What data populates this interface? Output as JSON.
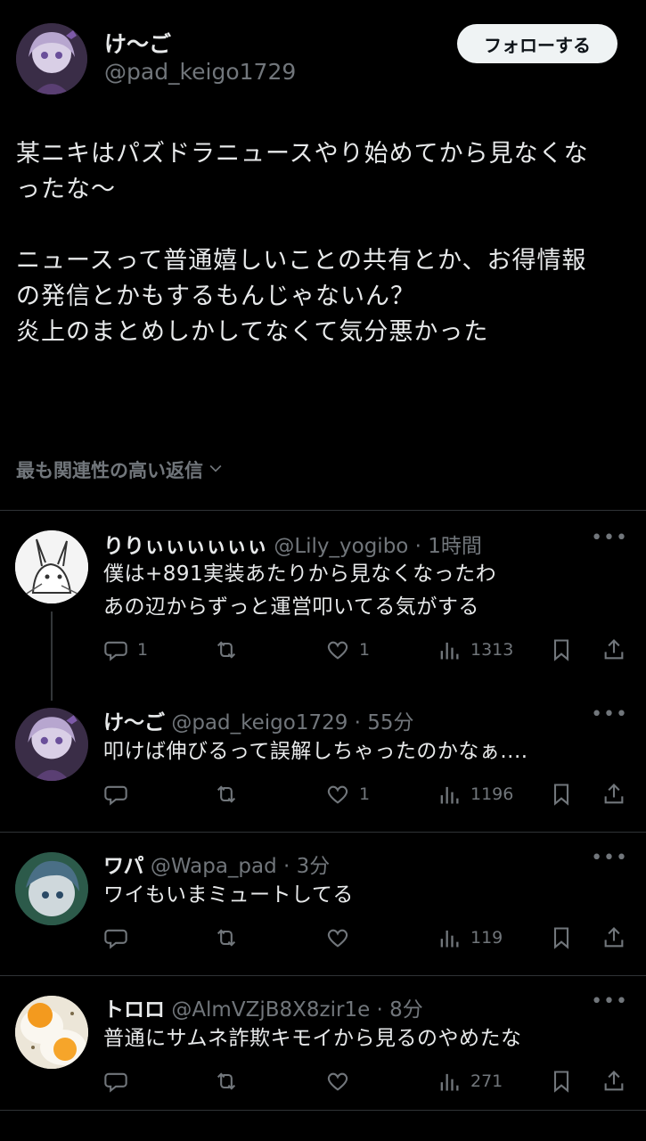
{
  "post": {
    "author_name": "け〜ご",
    "author_handle": "@pad_keigo1729",
    "follow_label": "フォローする",
    "text_lines": [
      "某ニキはパズドラニュースやり始めてから見なくな",
      "ったな〜",
      "",
      "ニュースって普通嬉しいことの共有とか、お得情報",
      "の発信とかもするもんじゃないん？",
      "炎上のまとめしかしてなくて気分悪かった"
    ],
    "sort_label": "最も関連性の高い返信"
  },
  "replies": [
    {
      "name": "りりぃぃぃぃぃぃ",
      "meta": "@Lily_yogibo · 1時間",
      "lines": [
        "僕は+891実装あたりから見なくなったわ",
        "あの辺からずっと運営叩いてる気がする"
      ],
      "reply_count": "1",
      "retweet_count": "",
      "like_count": "1",
      "view_count": "1313"
    },
    {
      "name": "け〜ご",
      "meta": "@pad_keigo1729 · 55分",
      "lines": [
        "叩けば伸びるって誤解しちゃったのかなぁ...."
      ],
      "reply_count": "",
      "retweet_count": "",
      "like_count": "1",
      "view_count": "1196"
    },
    {
      "name": "ワパ",
      "meta": "@Wapa_pad · 3分",
      "lines": [
        "ワイもいまミュートしてる"
      ],
      "reply_count": "",
      "retweet_count": "",
      "like_count": "",
      "view_count": "119"
    },
    {
      "name": "トロロ",
      "meta": "@AlmVZjB8X8zir1e · 8分",
      "lines": [
        "普通にサムネ詐欺キモイから見るのやめたな"
      ],
      "reply_count": "",
      "retweet_count": "",
      "like_count": "",
      "view_count": "271"
    }
  ],
  "icons": {
    "reply": "speech-bubble-icon",
    "retweet": "retweet-arrows-icon",
    "like": "heart-icon",
    "views": "bar-chart-icon",
    "bookmark": "bookmark-icon",
    "share": "share-upload-icon",
    "more": "ellipsis-icon",
    "sort_chevron": "chevron-down-icon"
  },
  "colors": {
    "background": "#000000",
    "text": "#e7e9ea",
    "secondary": "#71767b",
    "follow_bg": "#eff3f4"
  }
}
